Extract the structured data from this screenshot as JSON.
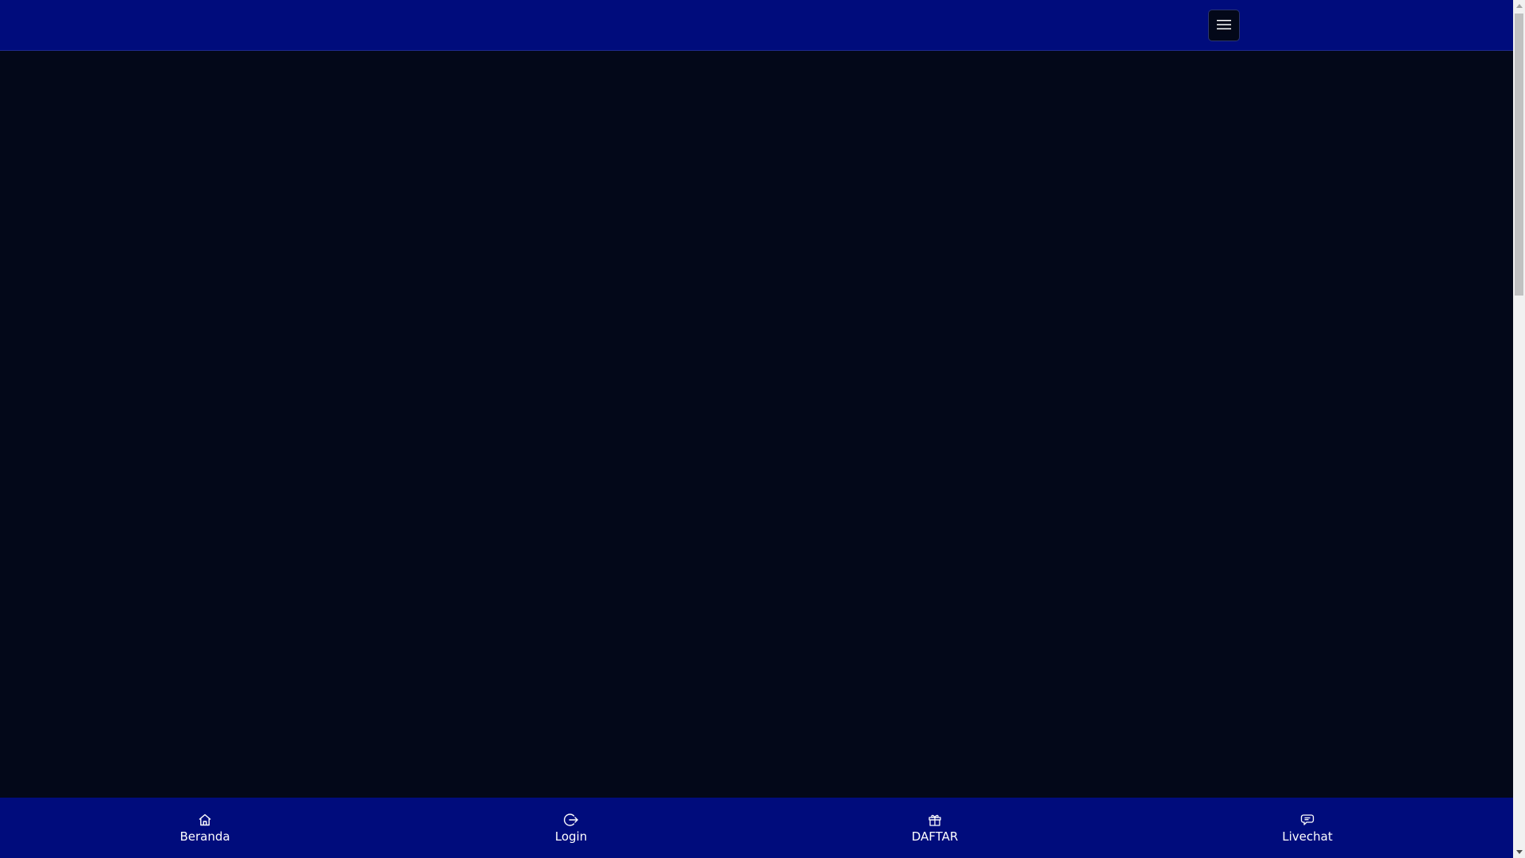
{
  "header": {
    "menu_toggle_icon": "hamburger-icon"
  },
  "colors": {
    "header_bg": "#000c7c",
    "page_bg": "#030819",
    "nav_bg": "#000c7c",
    "text": "#ffffff"
  },
  "bottom_nav": {
    "items": [
      {
        "label": "Beranda",
        "icon": "home-icon"
      },
      {
        "label": "Login",
        "icon": "login-icon"
      },
      {
        "label": "DAFTAR",
        "icon": "gift-icon"
      },
      {
        "label": "Livechat",
        "icon": "chat-icon"
      }
    ]
  }
}
